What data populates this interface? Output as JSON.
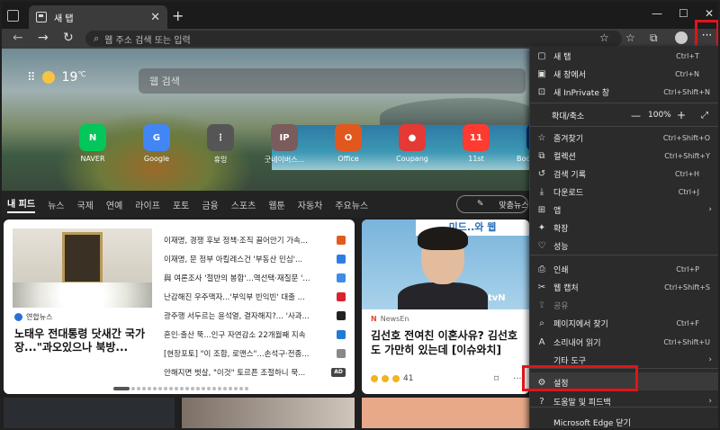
{
  "window": {
    "tab_title": "새 탭",
    "close_tab": "✕",
    "new_tab": "+",
    "minimize": "—",
    "maximize": "☐",
    "close": "✕"
  },
  "address": {
    "placeholder": "웹 주소 검색 또는 입력",
    "more_button": "···"
  },
  "hero": {
    "temperature": "19",
    "temperature_unit": "℃",
    "search_placeholder": "웹 검색",
    "quick_links": [
      {
        "label": "NAVER",
        "badge": "N",
        "color": "#03c75a"
      },
      {
        "label": "Google",
        "badge": "G",
        "color": "#4285f4"
      },
      {
        "label": "휴잉",
        "badge": "⋮",
        "color": "#555555"
      },
      {
        "label": "굿네이버스...",
        "badge": "IP",
        "color": "#7a5c5c"
      },
      {
        "label": "Office",
        "badge": "O",
        "color": "#e2571e"
      },
      {
        "label": "Coupang",
        "badge": "●",
        "color": "#e53935"
      },
      {
        "label": "11st",
        "badge": "11",
        "color": "#ff3b30"
      },
      {
        "label": "Booking.com",
        "badge": "B",
        "color": "#003580"
      }
    ]
  },
  "news_nav": {
    "items": [
      "내 피드",
      "뉴스",
      "국제",
      "연예",
      "라이프",
      "포토",
      "금융",
      "스포츠",
      "웹툰",
      "자동차",
      "주요뉴스"
    ],
    "customize": "맞춤뉴스 설정"
  },
  "card1": {
    "source": "연합뉴스",
    "headline": "노태우 전대통령 닷새간 국가장...\"과오있으나 북방...",
    "list": [
      "이재명, 경쟁 후보 정책·조직 끌어안기 가속...",
      "이재명, 문 정부 아킬레스건 '부동산 민심'...",
      "與 여론조사 '절반의 봉합'...역선택·재질문 '...",
      "난감해진 우주맥자...'부익부 빈익빈' 대출 ...",
      "광주행 서두르는 윤석열, 결자해지?... '사과...",
      "혼인·출산 뚝...인구 자연감소 22개월째 지속",
      "[현장포토] \"이 조합, 로맨스\"...손석구·전종...",
      "안해지면 벗살, \"이것\" 토르픈 조절하니 묵..."
    ],
    "ad_badge": "AD"
  },
  "card2": {
    "sign_text": "미드..와 웹",
    "tvn": "tvN",
    "source": "NewsEn",
    "headline": "김선호 전여친 이혼사유? 김선호도 가만히 있는데 [이슈와치]",
    "reactions": "41",
    "bookmark": "⌑",
    "more": "···"
  },
  "menu": {
    "items": [
      {
        "icon": "▢",
        "label": "새 탭",
        "shortcut": "Ctrl+T"
      },
      {
        "icon": "▣",
        "label": "새 창에서",
        "shortcut": "Ctrl+N"
      },
      {
        "icon": "⊡",
        "label": "새 InPrivate 창",
        "shortcut": "Ctrl+Shift+N"
      },
      {
        "icon": "☆",
        "label": "즐겨찾기",
        "shortcut": "Ctrl+Shift+O"
      },
      {
        "icon": "⧉",
        "label": "컬렉션",
        "shortcut": "Ctrl+Shift+Y"
      },
      {
        "icon": "↺",
        "label": "검색 기록",
        "shortcut": "Ctrl+H"
      },
      {
        "icon": "⤓",
        "label": "다운로드",
        "shortcut": "Ctrl+J"
      },
      {
        "icon": "⊞",
        "label": "앱",
        "shortcut": ""
      },
      {
        "icon": "✦",
        "label": "확장",
        "shortcut": ""
      },
      {
        "icon": "♡",
        "label": "성능",
        "shortcut": ""
      },
      {
        "icon": "⎙",
        "label": "인쇄",
        "shortcut": "Ctrl+P"
      },
      {
        "icon": "✂",
        "label": "웹 캡처",
        "shortcut": "Ctrl+Shift+S"
      },
      {
        "icon": "⇪",
        "label": "공유",
        "shortcut": ""
      },
      {
        "icon": "⌕",
        "label": "페이지에서 찾기",
        "shortcut": "Ctrl+F"
      },
      {
        "icon": "A",
        "label": "소리내어 읽기",
        "shortcut": "Ctrl+Shift+U"
      },
      {
        "icon": "",
        "label": "기타 도구",
        "shortcut": ""
      },
      {
        "icon": "⚙",
        "label": "설정",
        "shortcut": ""
      },
      {
        "icon": "?",
        "label": "도움말 및 피드백",
        "shortcut": ""
      },
      {
        "icon": "",
        "label": "Microsoft Edge 닫기",
        "shortcut": ""
      }
    ],
    "zoom_label": "확대/축소",
    "zoom_value": "100%",
    "zoom_minus": "—",
    "zoom_plus": "+",
    "zoom_full": "⤢",
    "arrow": "›"
  },
  "colors": {
    "highlight": "#e0141a"
  }
}
